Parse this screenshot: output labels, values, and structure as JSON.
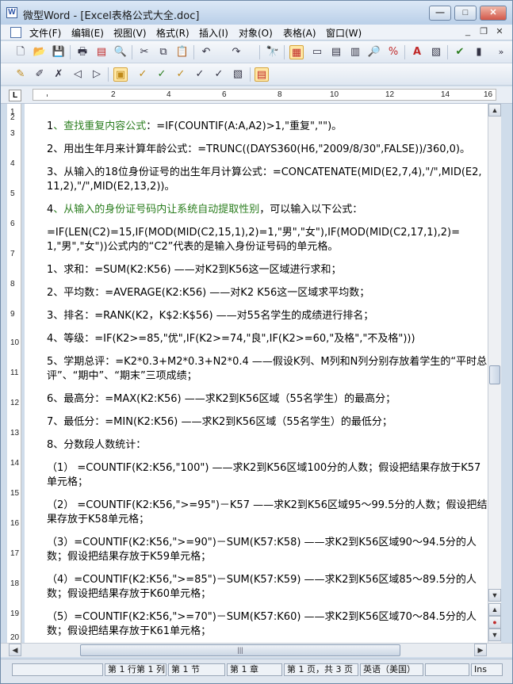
{
  "window": {
    "title": "微型Word - [Excel表格公式大全.doc]",
    "min": "—",
    "max": "□",
    "close": "✕"
  },
  "menu": [
    "文件(F)",
    "编辑(E)",
    "视图(V)",
    "格式(R)",
    "插入(I)",
    "对象(O)",
    "表格(A)",
    "窗口(W)"
  ],
  "mdi": {
    "min": "_",
    "restore": "❐",
    "close": "✕"
  },
  "ruler": {
    "corner": "L",
    "numbers": [
      "2",
      "4",
      "6",
      "8",
      "10",
      "12",
      "14",
      "16"
    ]
  },
  "vruler": [
    "1",
    "2",
    "3",
    "4",
    "5",
    "6",
    "7",
    "8",
    "9",
    "10",
    "11",
    "12",
    "13",
    "14",
    "15",
    "16",
    "17",
    "18",
    "19",
    "20"
  ],
  "doc": {
    "p1": {
      "num": "1",
      "green": "、查找重复内容公式",
      "rest": "：=IF(COUNTIF(A:A,A2)>1,\"重复\",\"\")。"
    },
    "p2": "2、用出生年月来计算年龄公式：=TRUNC((DAYS360(H6,\"2009/8/30\",FALSE))/360,0)。",
    "p3": "3、从输入的18位身份证号的出生年月计算公式：=CONCATENATE(MID(E2,7,4),\"/\",MID(E2,11,2),\"/\",MID(E2,13,2))。",
    "p4": {
      "num": "4",
      "green": "、从输入的身份证号码内让系统自动提取性别",
      "rest": "，可以输入以下公式："
    },
    "p5": "=IF(LEN(C2)=15,IF(MOD(MID(C2,15,1),2)=1,\"男\",\"女\"),IF(MOD(MID(C2,17,1),2)=1,\"男\",\"女\"))公式内的“C2”代表的是输入身份证号码的单元格。",
    "p6": "1、求和：=SUM(K2:K56) ——对K2到K56这一区域进行求和；",
    "p7": "2、平均数：=AVERAGE(K2:K56) ——对K2 K56这一区域求平均数；",
    "p8": "3、排名：=RANK(K2，K$2:K$56) ——对55名学生的成绩进行排名；",
    "p9": "4、等级：=IF(K2>=85,\"优\",IF(K2>=74,\"良\",IF(K2>=60,\"及格\",\"不及格\")))",
    "p10": "5、学期总评：=K2*0.3+M2*0.3+N2*0.4 ——假设K列、M列和N列分别存放着学生的“平时总评”、“期中”、“期末”三项成绩；",
    "p11": "6、最高分：=MAX(K2:K56) ——求K2到K56区域（55名学生）的最高分；",
    "p12": "7、最低分：=MIN(K2:K56) ——求K2到K56区域（55名学生）的最低分；",
    "p13": "8、分数段人数统计：",
    "p14": "（1） =COUNTIF(K2:K56,\"100\") ——求K2到K56区域100分的人数；假设把结果存放于K57单元格；",
    "p15": "（2） =COUNTIF(K2:K56,\">=95\")－K57 ——求K2到K56区域95～99.5分的人数；假设把结果存放于K58单元格；",
    "p16": "（3）=COUNTIF(K2:K56,\">=90\")－SUM(K57:K58) ——求K2到K56区域90～94.5分的人数；假设把结果存放于K59单元格；",
    "p17": "（4）=COUNTIF(K2:K56,\">=85\")－SUM(K57:K59) ——求K2到K56区域85～89.5分的人数；假设把结果存放于K60单元格；",
    "p18": "（5）=COUNTIF(K2:K56,\">=70\")－SUM(K57:K60) ——求K2到K56区域70～84.5分的人数；假设把结果存放于K61单元格；"
  },
  "status": {
    "pos": "第 1 行第 1 列",
    "section": "第 1 节",
    "chapter": "第 1 章",
    "page": "第 1 页，共 3 页",
    "lang": "英语（美国）",
    "mode": "Ins"
  },
  "scroll": {
    "grip": "|||",
    "up": "▲",
    "down": "▼",
    "left": "◀",
    "right": "▶",
    "prev": "▲",
    "dot": "●",
    "next": "▼"
  }
}
